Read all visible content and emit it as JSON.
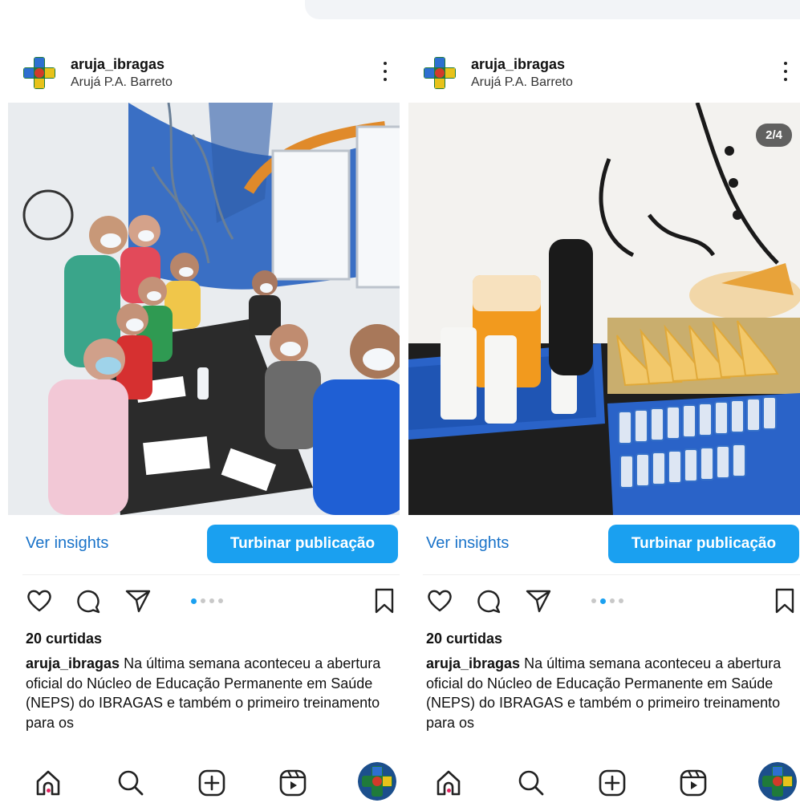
{
  "posts": [
    {
      "username": "aruja_ibragas",
      "location": "Arujá P.A. Barreto",
      "counter": "",
      "insights_label": "Ver insights",
      "boost_label": "Turbinar publicação",
      "likes": "20 curtidas",
      "caption_user": "aruja_ibragas",
      "caption_text": " Na última semana aconteceu a abertura oficial do Núcleo de Educação Permanente em Saúde (NEPS) do IBRAGAS e também o primeiro treinamento para os",
      "carousel_active": 1,
      "carousel_total": 4,
      "photo_description_icon": "group-training-photo"
    },
    {
      "username": "aruja_ibragas",
      "location": "Arujá P.A. Barreto",
      "counter": "2/4",
      "insights_label": "Ver insights",
      "boost_label": "Turbinar publicação",
      "likes": "20 curtidas",
      "caption_user": "aruja_ibragas",
      "caption_text": " Na última semana aconteceu a abertura oficial do Núcleo de Educação Permanente em Saúde (NEPS) do IBRAGAS e também o primeiro treinamento para os",
      "carousel_active": 2,
      "carousel_total": 4,
      "photo_description_icon": "snack-table-photo"
    }
  ],
  "icons": {
    "like": "heart-icon",
    "comment": "comment-icon",
    "share": "send-icon",
    "save": "bookmark-icon",
    "more": "more-vertical-icon",
    "nav": [
      "home-icon",
      "search-icon",
      "create-icon",
      "reels-icon",
      "profile-avatar"
    ]
  },
  "colors": {
    "accent": "#1aa0f0",
    "link": "#1a73c9",
    "notification_dot": "#e0245e"
  }
}
